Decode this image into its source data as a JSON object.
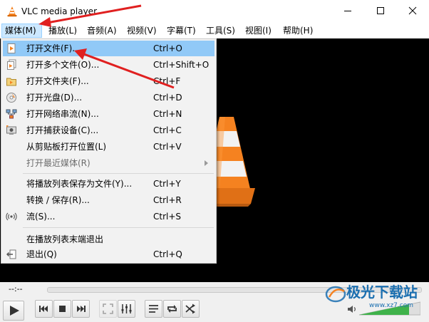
{
  "window": {
    "title": "VLC media player",
    "controls": [
      "minimize-icon",
      "maximize-icon",
      "close-icon"
    ]
  },
  "menubar": {
    "items": [
      {
        "label": "媒体(M)",
        "active": true
      },
      {
        "label": "播放(L)"
      },
      {
        "label": "音频(A)"
      },
      {
        "label": "视频(V)"
      },
      {
        "label": "字幕(T)"
      },
      {
        "label": "工具(S)"
      },
      {
        "label": "视图(I)"
      },
      {
        "label": "帮助(H)"
      }
    ]
  },
  "media_menu": {
    "items": [
      {
        "label": "打开文件(F)...",
        "shortcut": "Ctrl+O",
        "icon": "open-file-icon",
        "highlighted": true
      },
      {
        "label": "打开多个文件(O)...",
        "shortcut": "Ctrl+Shift+O",
        "icon": "open-multiple-files-icon"
      },
      {
        "label": "打开文件夹(F)...",
        "shortcut": "Ctrl+F",
        "icon": "open-folder-icon"
      },
      {
        "label": "打开光盘(D)...",
        "shortcut": "Ctrl+D",
        "icon": "disc-icon"
      },
      {
        "label": "打开网络串流(N)...",
        "shortcut": "Ctrl+N",
        "icon": "network-icon"
      },
      {
        "label": "打开捕获设备(C)...",
        "shortcut": "Ctrl+C",
        "icon": "capture-device-icon"
      },
      {
        "label": "从剪贴板打开位置(L)",
        "shortcut": "Ctrl+V"
      },
      {
        "label": "打开最近媒体(R)",
        "disabled": true,
        "submenu": true
      },
      {
        "label": "将播放列表保存为文件(Y)...",
        "shortcut": "Ctrl+Y"
      },
      {
        "label": "转换 / 保存(R)...",
        "shortcut": "Ctrl+R"
      },
      {
        "label": "流(S)...",
        "shortcut": "Ctrl+S",
        "icon": "stream-icon"
      },
      {
        "label": "在播放列表末端退出"
      },
      {
        "label": "退出(Q)",
        "shortcut": "Ctrl+Q",
        "icon": "quit-icon"
      }
    ]
  },
  "controls": {
    "time": "--:--",
    "buttons": [
      "play-icon",
      "previous-icon",
      "stop-icon",
      "next-icon",
      "fullscreen-icon",
      "extended-settings-icon",
      "playlist-icon",
      "loop-icon",
      "shuffle-icon"
    ]
  },
  "watermark": {
    "text": "极光下载站",
    "url": "www.xz7.com"
  },
  "colors": {
    "menu_highlight": "#91c9f7",
    "annotation_arrow": "#e02020",
    "vlc_orange": "#f58220"
  }
}
